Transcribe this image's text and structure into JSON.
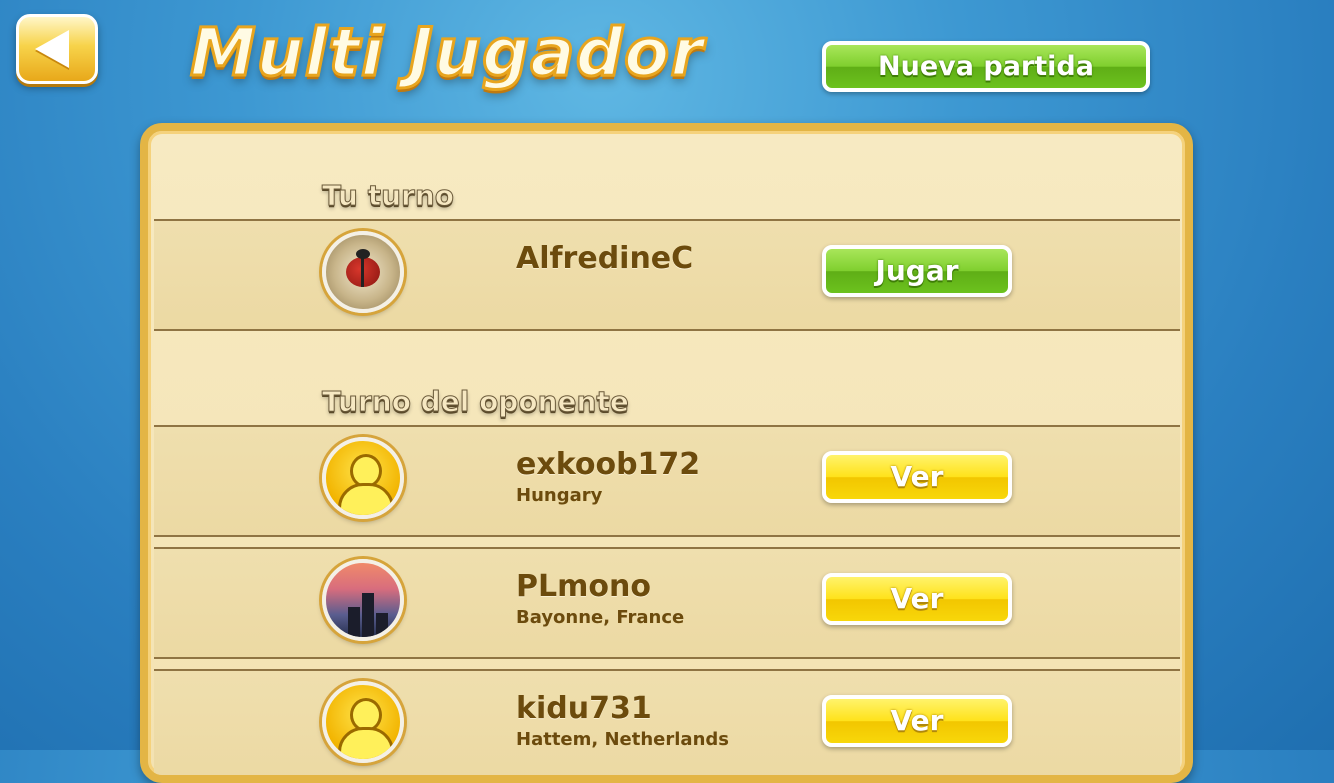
{
  "header": {
    "title": "Multi Jugador",
    "new_game_label": "Nueva partida"
  },
  "sections": {
    "your_turn": "Tu turno",
    "opponent_turn": "Turno del oponente"
  },
  "your_turn_games": [
    {
      "name": "AlfredineC",
      "location": "",
      "avatar": "ladybug-photo",
      "action": "Jugar"
    }
  ],
  "opponent_games": [
    {
      "name": "exkoob172",
      "location": "Hungary",
      "avatar": "default-person-icon",
      "action": "Ver"
    },
    {
      "name": "PLmono",
      "location": "Bayonne, France",
      "avatar": "city-photo",
      "action": "Ver"
    },
    {
      "name": "kidu731",
      "location": "Hattem, Netherlands",
      "avatar": "default-person-icon",
      "action": "Ver"
    }
  ],
  "colors": {
    "background": "#3d98d2",
    "panel": "#f3e2b1",
    "panel_border": "#e3b545",
    "primary_button": "#7fcf2e",
    "secondary_button": "#ffe21a",
    "text_brown": "#6c4b0d"
  }
}
